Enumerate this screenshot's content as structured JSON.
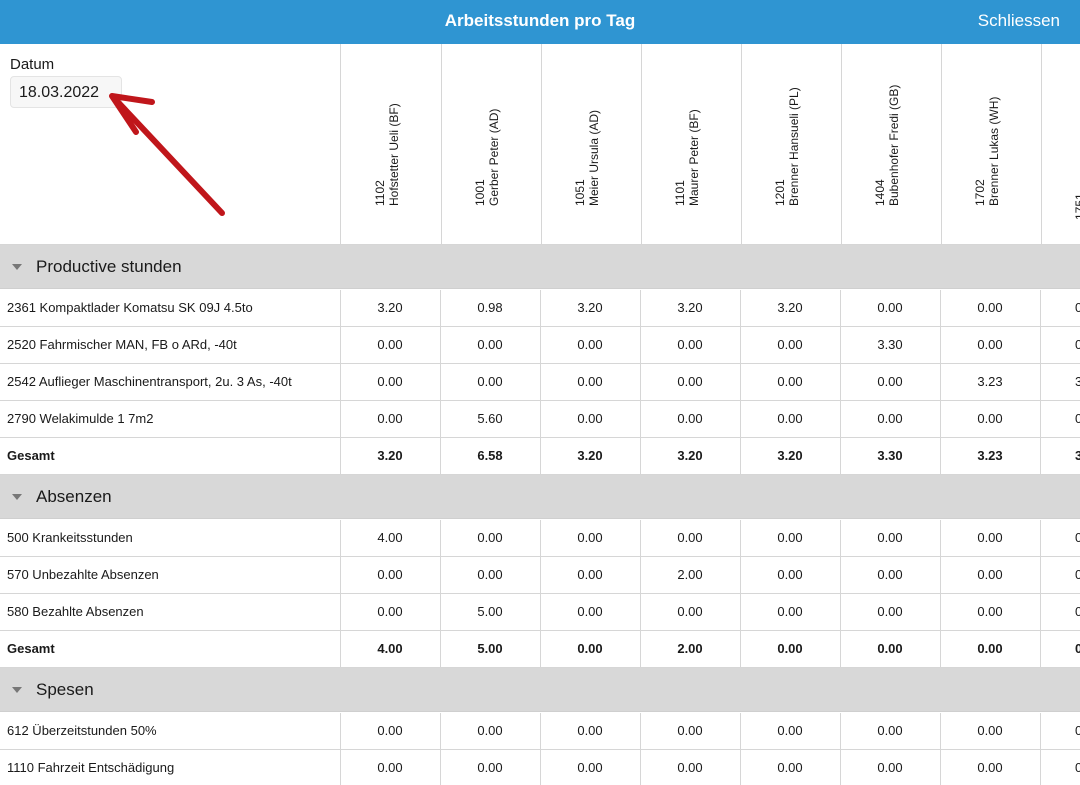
{
  "header": {
    "title": "Arbeitsstunden pro Tag",
    "close_label": "Schliessen"
  },
  "date": {
    "label": "Datum",
    "value": "18.03.2022"
  },
  "employees": [
    {
      "id": "1102",
      "name": "Hofstetter Ueli (BF)"
    },
    {
      "id": "1001",
      "name": "Gerber Peter (AD)"
    },
    {
      "id": "1051",
      "name": "Meier Ursula (AD)"
    },
    {
      "id": "1101",
      "name": "Maurer Peter (BF)"
    },
    {
      "id": "1201",
      "name": "Brenner Hansueli (PL)"
    },
    {
      "id": "1404",
      "name": "Bubenhofer Fredi (GB)"
    },
    {
      "id": "1702",
      "name": "Brenner Lukas (WH)"
    },
    {
      "id": "1751",
      "name": ""
    }
  ],
  "sections": [
    {
      "title": "Productive stunden",
      "rows": [
        {
          "label": "2361 Kompaktlader Komatsu SK 09J 4.5to",
          "values": [
            "3.20",
            "0.98",
            "3.20",
            "3.20",
            "3.20",
            "0.00",
            "0.00"
          ],
          "clip": "0"
        },
        {
          "label": "2520 Fahrmischer MAN, FB o ARd, -40t",
          "values": [
            "0.00",
            "0.00",
            "0.00",
            "0.00",
            "0.00",
            "3.30",
            "0.00"
          ],
          "clip": "0"
        },
        {
          "label": "2542 Auflieger Maschinentransport, 2u. 3 As, -40t",
          "values": [
            "0.00",
            "0.00",
            "0.00",
            "0.00",
            "0.00",
            "0.00",
            "3.23"
          ],
          "clip": "3"
        },
        {
          "label": "2790 Welakimulde 1 7m2",
          "values": [
            "0.00",
            "5.60",
            "0.00",
            "0.00",
            "0.00",
            "0.00",
            "0.00"
          ],
          "clip": "0"
        }
      ],
      "total": {
        "label": "Gesamt",
        "values": [
          "3.20",
          "6.58",
          "3.20",
          "3.20",
          "3.20",
          "3.30",
          "3.23"
        ],
        "clip": "3"
      }
    },
    {
      "title": "Absenzen",
      "rows": [
        {
          "label": "500 Krankeitsstunden",
          "values": [
            "4.00",
            "0.00",
            "0.00",
            "0.00",
            "0.00",
            "0.00",
            "0.00"
          ],
          "clip": "0"
        },
        {
          "label": "570 Unbezahlte Absenzen",
          "values": [
            "0.00",
            "0.00",
            "0.00",
            "2.00",
            "0.00",
            "0.00",
            "0.00"
          ],
          "clip": "0"
        },
        {
          "label": "580 Bezahlte Absenzen",
          "values": [
            "0.00",
            "5.00",
            "0.00",
            "0.00",
            "0.00",
            "0.00",
            "0.00"
          ],
          "clip": "0"
        }
      ],
      "total": {
        "label": "Gesamt",
        "values": [
          "4.00",
          "5.00",
          "0.00",
          "2.00",
          "0.00",
          "0.00",
          "0.00"
        ],
        "clip": "0"
      }
    },
    {
      "title": "Spesen",
      "rows": [
        {
          "label": "612 Überzeitstunden 50%",
          "values": [
            "0.00",
            "0.00",
            "0.00",
            "0.00",
            "0.00",
            "0.00",
            "0.00"
          ],
          "clip": "0"
        },
        {
          "label": "1110 Fahrzeit Entschädigung",
          "values": [
            "0.00",
            "0.00",
            "0.00",
            "0.00",
            "0.00",
            "0.00",
            "0.00"
          ],
          "clip": "0"
        }
      ]
    }
  ],
  "colors": {
    "header_bg": "#2f95d2",
    "section_bg": "#d8d8d8",
    "arrow": "#c0161b"
  }
}
